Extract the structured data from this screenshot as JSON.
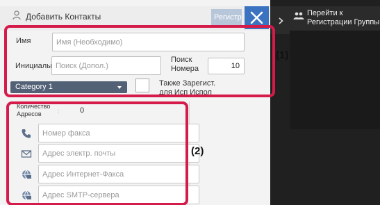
{
  "dialog": {
    "title": "Добавить Контакты",
    "register_label": "Регистр",
    "close_icon": "close-icon"
  },
  "form": {
    "name_label": "Имя",
    "name_placeholder": "Имя (Необходимо)",
    "initials_label": "Инициалы",
    "initials_placeholder": "Поиск (Допол.)",
    "search_number_label_line1": "Поиск",
    "search_number_label_line2": "Номера",
    "search_number_value": "10",
    "category_value": "Category 1",
    "also_register_label": "Также Зарегист. для Исп Испол"
  },
  "addresses": {
    "count_label_line1": "Количество",
    "count_label_line2": "Адресов",
    "count_separator": ":",
    "count_value": "0",
    "fields": [
      {
        "icon": "phone-icon",
        "placeholder": "Номер факса"
      },
      {
        "icon": "envelope-icon",
        "placeholder": "Адрес электр. почты"
      },
      {
        "icon": "internet-fax-icon",
        "placeholder": "Адрес Интернет-Факса"
      },
      {
        "icon": "smtp-server-icon",
        "placeholder": "Адрес SMTP-сервера"
      }
    ]
  },
  "callouts": {
    "one": "(1)",
    "two": "(2)"
  },
  "side_panel": {
    "goto_line1": "Перейти к",
    "goto_line2": "Регистрации Группы"
  },
  "colors": {
    "highlight": "#d51b4a",
    "close_button": "#3b73c0",
    "category_bg": "#536177",
    "dark_panel": "#202020"
  }
}
